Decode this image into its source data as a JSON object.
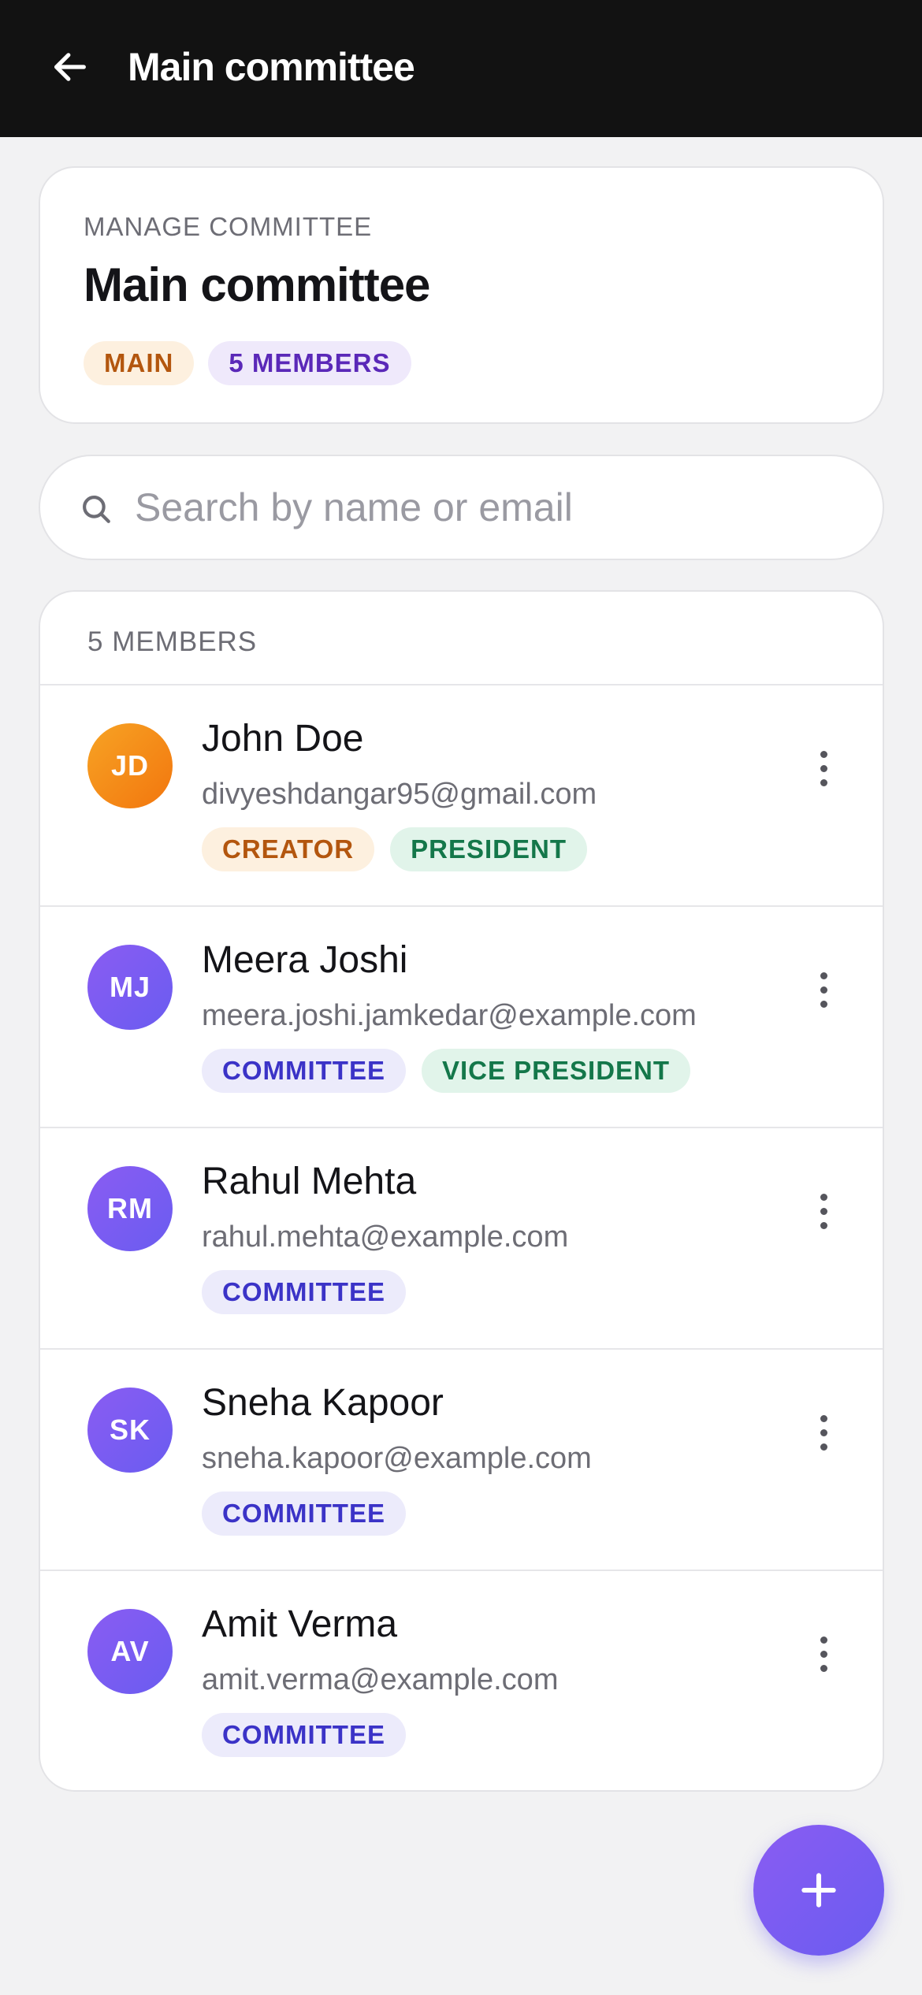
{
  "appbar": {
    "title": "Main committee",
    "back_icon": "arrow-left-icon"
  },
  "header": {
    "eyebrow": "MANAGE COMMITTEE",
    "title": "Main committee",
    "chips": [
      {
        "label": "MAIN",
        "color": "orange"
      },
      {
        "label": "5 MEMBERS",
        "color": "purple"
      }
    ]
  },
  "search": {
    "placeholder": "Search by name or email",
    "value": "",
    "icon": "search-icon"
  },
  "members": {
    "count_label": "5 MEMBERS",
    "items": [
      {
        "initials": "JD",
        "avatar_color": "#f2760e",
        "name": "John Doe",
        "email": "divyeshdangar95@gmail.com",
        "roles": [
          {
            "label": "CREATOR",
            "color": "orange"
          },
          {
            "label": "PRESIDENT",
            "color": "green"
          }
        ]
      },
      {
        "initials": "MJ",
        "avatar_color": "#6a5cf0",
        "name": "Meera Joshi",
        "email": "meera.joshi.jamkedar@example.com",
        "roles": [
          {
            "label": "COMMITTEE",
            "color": "indigo"
          },
          {
            "label": "VICE PRESIDENT",
            "color": "green"
          }
        ]
      },
      {
        "initials": "RM",
        "avatar_color": "#6a5cf0",
        "name": "Rahul Mehta",
        "email": "rahul.mehta@example.com",
        "roles": [
          {
            "label": "COMMITTEE",
            "color": "indigo"
          }
        ]
      },
      {
        "initials": "SK",
        "avatar_color": "#6a5cf0",
        "name": "Sneha Kapoor",
        "email": "sneha.kapoor@example.com",
        "roles": [
          {
            "label": "COMMITTEE",
            "color": "indigo"
          }
        ]
      },
      {
        "initials": "AV",
        "avatar_color": "#6a5cf0",
        "name": "Amit Verma",
        "email": "amit.verma@example.com",
        "roles": [
          {
            "label": "COMMITTEE",
            "color": "indigo"
          }
        ]
      }
    ]
  },
  "fab": {
    "icon": "plus-icon"
  },
  "colors": {
    "appbar_bg": "#121212",
    "page_bg": "#f2f2f3",
    "accent": "#6a5cf0"
  }
}
